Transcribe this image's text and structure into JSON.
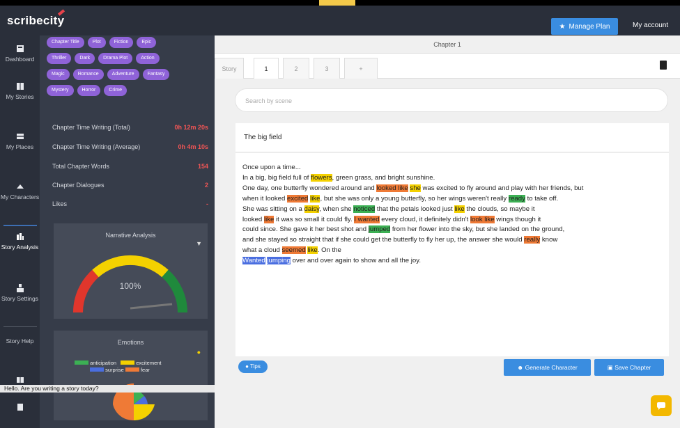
{
  "app": {
    "logo": "scribecity",
    "manage_label": "Manage Plan",
    "account_label": "My account"
  },
  "nav": [
    {
      "label": "Dashboard",
      "icon": "dashboard-icon"
    },
    {
      "label": "My Stories",
      "icon": "book-icon"
    },
    {
      "label": "My Places",
      "icon": "map-icon"
    },
    {
      "label": "My Characters",
      "icon": "character-icon"
    },
    {
      "label": "Story Analysis",
      "icon": "analysis-icon"
    },
    {
      "label": "Story Settings",
      "icon": "settings-icon"
    },
    {
      "label": "Story Help",
      "icon": "help-icon"
    },
    {
      "label": "",
      "icon": "layers-icon"
    },
    {
      "label": "",
      "icon": "document-icon"
    }
  ],
  "tags": [
    [
      "Chapter Title",
      "Plot",
      "Fiction",
      "Epic"
    ],
    [
      "Thriller",
      "Dark",
      "Drama Plot",
      "Action"
    ],
    [
      "Magic",
      "Romance",
      "Adventure",
      "Fantasy"
    ],
    [
      "Mystery",
      "Horror",
      "Crime"
    ]
  ],
  "metrics": [
    {
      "label": "Chapter Time Writing (Total)",
      "value": "0h 12m 20s"
    },
    {
      "label": "Chapter Time Writing (Average)",
      "value": "0h 4m 10s"
    },
    {
      "label": "Total Chapter Words",
      "value": "154"
    },
    {
      "label": "Chapter Dialogues",
      "value": "2"
    },
    {
      "label": "Likes",
      "value": "-"
    }
  ],
  "gauge_card": {
    "title": "Narrative Analysis",
    "value": "100%"
  },
  "emotions_card": {
    "title": "Emotions",
    "legend": [
      "anticipation",
      "excitement",
      "surprise",
      "fear"
    ],
    "colors": {
      "green": "#3cb054",
      "yellow": "#f4d100",
      "blue": "#4a6ee0",
      "orange": "#ef7a36"
    }
  },
  "bottom_label": "Hello. Are you writing a story today?",
  "editor": {
    "header": "Chapter 1",
    "tabs": [
      "Story",
      "1",
      "2",
      "3",
      "+"
    ],
    "search_placeholder": "Search by scene",
    "scene_title": "The big field",
    "tips_label": "Tips",
    "generate_label": "Generate Character",
    "save_label": "Save Chapter"
  },
  "story_lines": [
    [
      [
        "Once upon a time...",
        ""
      ]
    ],
    [
      [
        "In a big, big field full of ",
        ""
      ],
      [
        "flowers",
        "y"
      ],
      [
        ", green grass, and bright sunshine.",
        ""
      ]
    ],
    [
      [
        "One day, one butterfly wondered around and ",
        ""
      ],
      [
        "looked like",
        "o"
      ],
      [
        " ",
        ""
      ],
      [
        "she",
        "y"
      ],
      [
        " was excited to fly around and play with her friends, but",
        ""
      ]
    ],
    [
      [
        "when it looked ",
        ""
      ],
      [
        "excited",
        "o"
      ],
      [
        " ",
        ""
      ],
      [
        "like",
        "y"
      ],
      [
        ", but she was only a young butterfly, so her wings weren't really ",
        ""
      ],
      [
        "ready",
        "g"
      ],
      [
        " to take off.",
        ""
      ]
    ],
    [
      [
        "She was sitting on a ",
        ""
      ],
      [
        "daisy",
        "y"
      ],
      [
        ", when she ",
        ""
      ],
      [
        "noticed",
        "g"
      ],
      [
        " that the petals looked just ",
        ""
      ],
      [
        "like",
        "y"
      ],
      [
        " the clouds, so maybe it",
        ""
      ]
    ],
    [
      [
        "looked ",
        ""
      ],
      [
        "like",
        "o"
      ],
      [
        " it was so small it could fly. ",
        ""
      ],
      [
        "I wanted",
        "o"
      ],
      [
        " every cloud, it definitely didn't ",
        ""
      ],
      [
        "look like",
        "o"
      ],
      [
        " wings though it",
        ""
      ]
    ],
    [
      [
        "could since. She gave it her best shot and ",
        ""
      ],
      [
        "jumped",
        "g"
      ],
      [
        " from her flower into the sky, but she landed on the ground,",
        ""
      ]
    ],
    [
      [
        "and she stayed so straight that if she could get the butterfly to fly her up, the answer she would ",
        ""
      ],
      [
        "really",
        "o"
      ],
      [
        " know",
        ""
      ]
    ],
    [
      [
        "what a cloud ",
        ""
      ],
      [
        "seemed",
        "o"
      ],
      [
        " ",
        ""
      ],
      [
        "like",
        "y"
      ],
      [
        ". On the",
        ""
      ]
    ],
    [
      [
        "Wanted",
        "b"
      ],
      [
        " ",
        ""
      ],
      [
        "jumping",
        "b"
      ],
      [
        " over and over again to show and all the joy.",
        ""
      ]
    ]
  ]
}
